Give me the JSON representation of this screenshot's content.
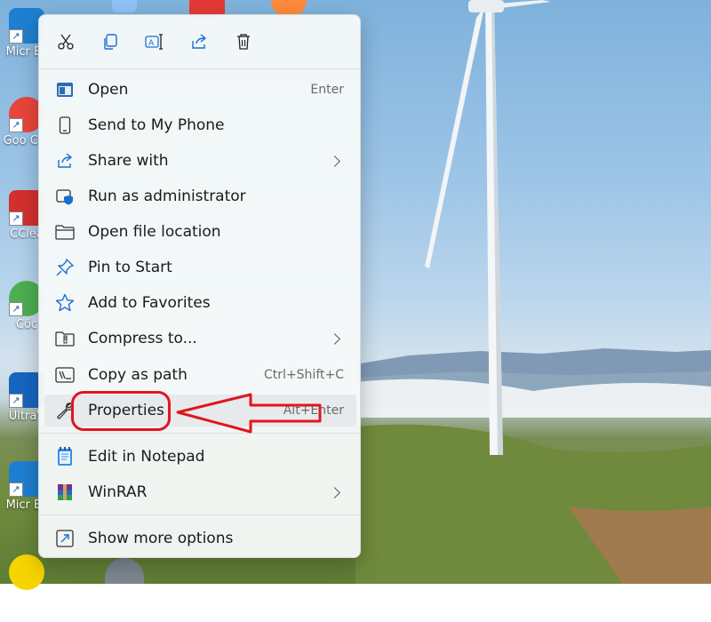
{
  "desktop": {
    "icons": [
      {
        "label": "Micr Ec",
        "color": "#1e7fd0"
      },
      {
        "label": "Goo Chr",
        "color": "#e8453c"
      },
      {
        "label": "CClea",
        "color": "#d32f2f"
      },
      {
        "label": "Cốc",
        "color": "#4caf50"
      },
      {
        "label": "UltraV",
        "color": "#1565c0"
      },
      {
        "label": "Micr Ec",
        "color": "#1e7fd0"
      }
    ]
  },
  "quick_actions": [
    {
      "name": "cut",
      "icon": "scissors-icon"
    },
    {
      "name": "copy",
      "icon": "copy-icon"
    },
    {
      "name": "rename",
      "icon": "rename-icon"
    },
    {
      "name": "share",
      "icon": "share-icon"
    },
    {
      "name": "delete",
      "icon": "trash-icon"
    }
  ],
  "menu": {
    "items": [
      {
        "label": "Open",
        "shortcut": "Enter",
        "icon": "open-app-icon"
      },
      {
        "label": "Send to My Phone",
        "icon": "phone-icon"
      },
      {
        "label": "Share with",
        "submenu": true,
        "icon": "share-with-icon"
      },
      {
        "label": "Run as administrator",
        "icon": "shield-icon"
      },
      {
        "label": "Open file location",
        "icon": "folder-icon"
      },
      {
        "label": "Pin to Start",
        "icon": "pin-icon"
      },
      {
        "label": "Add to Favorites",
        "icon": "star-icon"
      },
      {
        "label": "Compress to...",
        "submenu": true,
        "icon": "zip-folder-icon"
      },
      {
        "label": "Copy as path",
        "shortcut": "Ctrl+Shift+C",
        "icon": "copy-path-icon"
      },
      {
        "label": "Properties",
        "shortcut": "Alt+Enter",
        "icon": "wrench-icon",
        "highlighted": true
      },
      {
        "label": "Edit in Notepad",
        "icon": "notepad-icon"
      },
      {
        "label": "WinRAR",
        "submenu": true,
        "icon": "winrar-icon"
      },
      {
        "label": "Show more options",
        "icon": "more-options-icon"
      }
    ]
  },
  "annotation": {
    "color": "#e0161d"
  }
}
